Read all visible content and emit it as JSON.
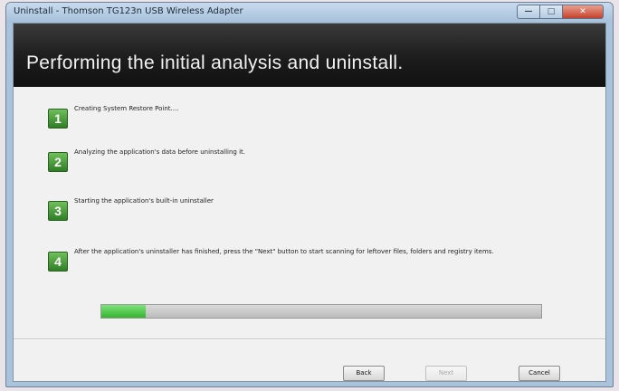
{
  "window": {
    "title": "Uninstall - Thomson TG123n USB Wireless Adapter",
    "controls": {
      "minimize": "—",
      "maximize": "□",
      "close": "✕"
    }
  },
  "header": {
    "title": "Performing the initial analysis and uninstall."
  },
  "steps": [
    {
      "number": "1",
      "text": "Creating System Restore Point....",
      "state": "done"
    },
    {
      "number": "2",
      "text": "Analyzing the application's data before uninstalling it.",
      "state": "done"
    },
    {
      "number": "3",
      "text": "Starting the application's built-in uninstaller",
      "state": "done"
    },
    {
      "number": "4",
      "text": "After the application's uninstaller has finished, press the \"Next\" button to start scanning for leftover files, folders and registry items.",
      "state": "pending"
    }
  ],
  "progress": {
    "percent": 10,
    "color": "#35b42f"
  },
  "buttons": {
    "back": "Back",
    "next": "Next",
    "cancel": "Cancel"
  }
}
